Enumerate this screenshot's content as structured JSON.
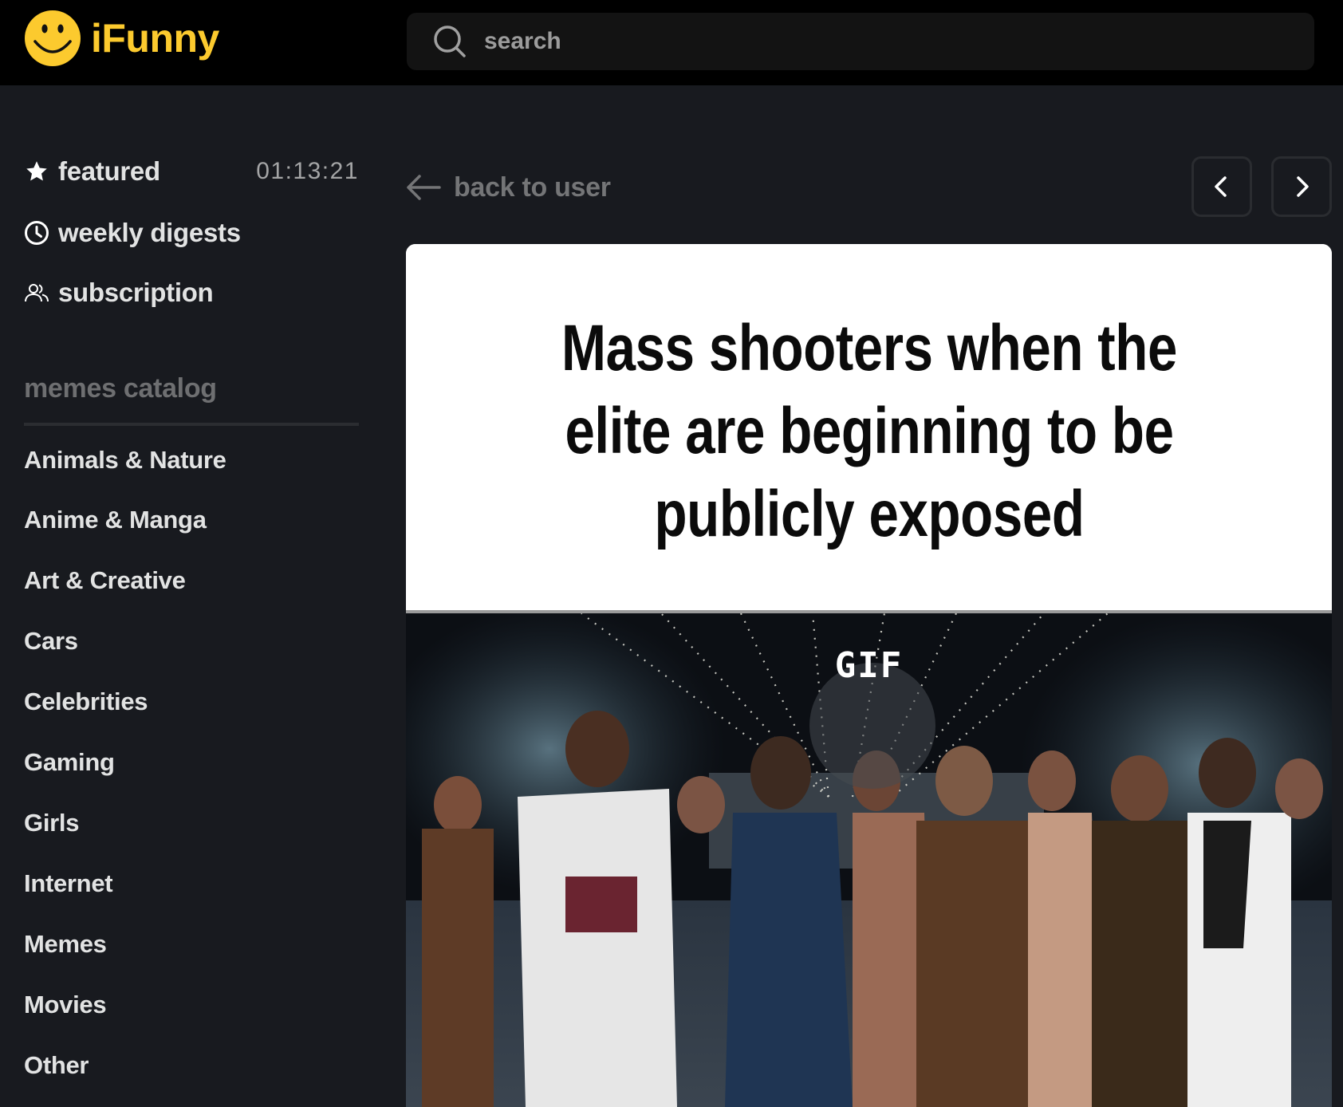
{
  "header": {
    "brand": "iFunny",
    "brand_color": "#fcca2e",
    "logo_icon": "smiley-face-icon",
    "search": {
      "placeholder": "search",
      "value": "",
      "icon": "search-icon"
    }
  },
  "sidebar": {
    "primary": [
      {
        "label": "featured",
        "icon": "star-icon",
        "timer": "01:13:21"
      },
      {
        "label": "weekly digests",
        "icon": "clock-icon"
      },
      {
        "label": "subscription",
        "icon": "users-icon"
      }
    ],
    "catalog_title": "memes catalog",
    "categories": [
      "Animals & Nature",
      "Anime & Manga",
      "Art & Creative",
      "Cars",
      "Celebrities",
      "Gaming",
      "Girls",
      "Internet",
      "Memes",
      "Movies",
      "Other"
    ]
  },
  "content": {
    "back_link": "back to user",
    "prev_label": "previous",
    "next_label": "next",
    "post": {
      "caption": "Mass shooters when the elite are beginning to be publicly exposed",
      "media_type_badge": "GIF"
    }
  },
  "colors": {
    "header_bg": "#000000",
    "page_bg": "#181a1f",
    "search_bg": "#131313",
    "muted_text": "#747577",
    "primary_text": "#e2e3e3"
  }
}
